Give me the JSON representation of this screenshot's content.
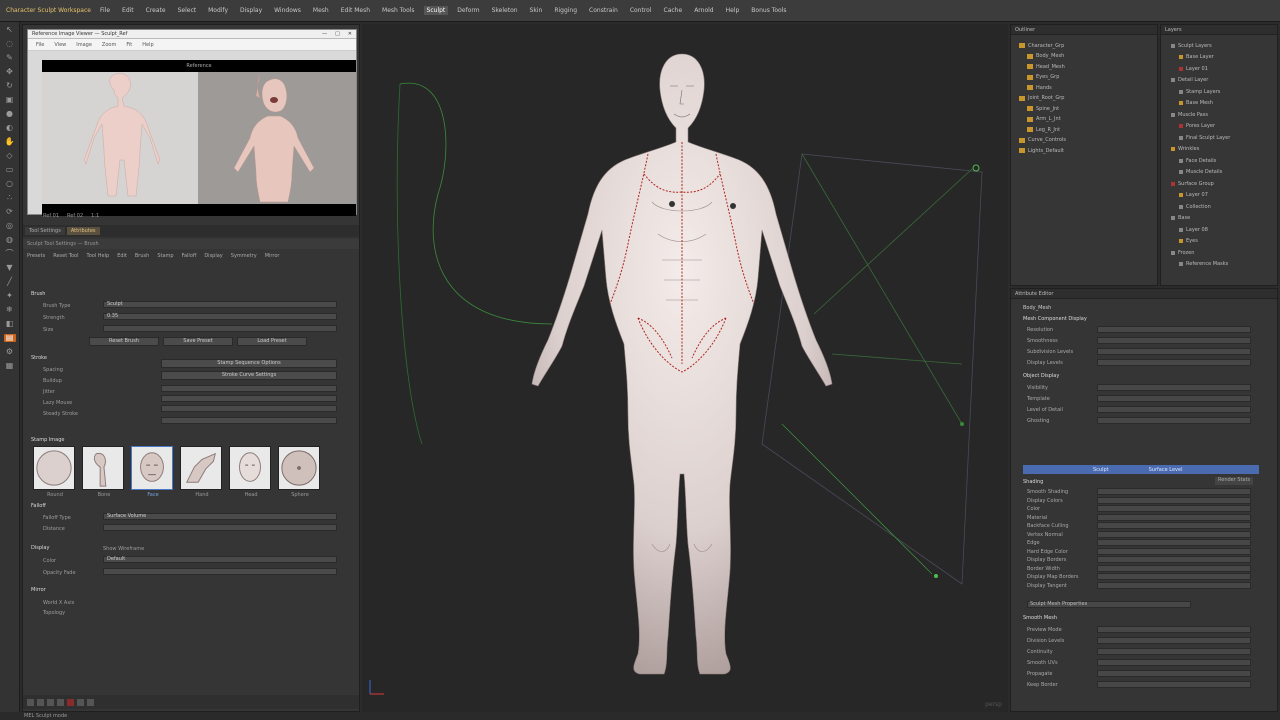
{
  "menubar": {
    "title": "Character Sculpt Workspace",
    "items": [
      "File",
      "Edit",
      "Create",
      "Select",
      "Modify",
      "Display",
      "Windows",
      "Mesh",
      "Edit Mesh",
      "Mesh Tools",
      "Sculpt",
      "Deform",
      "Skeleton",
      "Skin",
      "Rigging",
      "Constrain",
      "Control",
      "Cache",
      "Arnold",
      "Help",
      "Bonus Tools"
    ],
    "active_item": "Sculpt"
  },
  "tools": [
    {
      "icon": "select-arrow-icon",
      "glyph": "↖"
    },
    {
      "icon": "lasso-icon",
      "glyph": "◌"
    },
    {
      "icon": "paint-select-icon",
      "glyph": "✎"
    },
    {
      "icon": "move-icon",
      "glyph": "✥"
    },
    {
      "icon": "rotate-icon",
      "glyph": "↻"
    },
    {
      "icon": "scale-icon",
      "glyph": "▣"
    },
    {
      "icon": "sculpt-brush-icon",
      "glyph": "●"
    },
    {
      "icon": "smooth-icon",
      "glyph": "◐"
    },
    {
      "icon": "grab-icon",
      "glyph": "✋"
    },
    {
      "icon": "pinch-icon",
      "glyph": "◇"
    },
    {
      "icon": "flatten-icon",
      "glyph": "▭"
    },
    {
      "icon": "foamy-icon",
      "glyph": "○"
    },
    {
      "icon": "spray-icon",
      "glyph": "∴"
    },
    {
      "icon": "repeat-icon",
      "glyph": "⟳"
    },
    {
      "icon": "imprint-icon",
      "glyph": "◎"
    },
    {
      "icon": "wax-icon",
      "glyph": "◍"
    },
    {
      "icon": "scrape-icon",
      "glyph": "⌒"
    },
    {
      "icon": "fill-icon",
      "glyph": "▼"
    },
    {
      "icon": "knife-icon",
      "glyph": "╱"
    },
    {
      "icon": "amplify-icon",
      "glyph": "✦"
    },
    {
      "icon": "freeze-icon",
      "glyph": "❄"
    },
    {
      "icon": "mask-icon",
      "glyph": "◧"
    },
    {
      "icon": "camera-icon",
      "glyph": "▤"
    },
    {
      "icon": "settings-icon",
      "glyph": "⚙"
    },
    {
      "icon": "image-plane-icon",
      "glyph": "▦"
    }
  ],
  "reference": {
    "title": "Reference Image Viewer — Sculpt_Ref",
    "toolbar": [
      "File",
      "View",
      "Image",
      "Zoom",
      "Fit",
      "Help"
    ],
    "header": "Reference",
    "footer": [
      "Ref 01",
      "Ref 02",
      "1:1"
    ]
  },
  "left_tabs": [
    "Tool Settings",
    "Attributes"
  ],
  "left_sub": "Sculpt Tool Settings — Brush",
  "left_menu": [
    "Presets",
    "Reset Tool",
    "Tool Help",
    "Edit",
    "Brush",
    "Stamp",
    "Falloff",
    "Display",
    "Symmetry",
    "Mirror"
  ],
  "brush": {
    "section": "Brush",
    "label_type": "Brush Type",
    "type_value": "Sculpt",
    "label_strength": "Strength",
    "strength_value": "0.35",
    "label_size": "Size",
    "btn_reset": "Reset Brush",
    "btn_save": "Save Preset",
    "btn_load": "Load Preset"
  },
  "stroke": {
    "section": "Stroke",
    "labels": [
      "Spacing",
      "Buildup",
      "Jitter",
      "Lazy Mouse",
      "Steady Stroke"
    ],
    "btn_1": "Stamp Sequence Options",
    "btn_2": "Stroke Curve Settings"
  },
  "stamp": {
    "section": "Stamp Image",
    "thumbs": [
      "Round",
      "Bone",
      "Face",
      "Hand",
      "Head",
      "Sphere"
    ],
    "selected": 2
  },
  "falloff": {
    "section": "Falloff",
    "label": "Falloff Type",
    "value": "Surface Volume",
    "label2": "Distance"
  },
  "display": {
    "section": "Display",
    "label_a": "Show Wireframe",
    "label_b": "Color",
    "value_b": "Default",
    "label_c": "Opacity Fade"
  },
  "mirror": {
    "section": "Mirror",
    "label_a": "World X Axis",
    "label_b": "Topology"
  },
  "outliner": {
    "title": "Outliner",
    "rows": [
      {
        "label": "Character_Grp",
        "indent": 0
      },
      {
        "label": "Body_Mesh",
        "indent": 1
      },
      {
        "label": "Head_Mesh",
        "indent": 1
      },
      {
        "label": "Eyes_Grp",
        "indent": 1
      },
      {
        "label": "Hands",
        "indent": 1
      },
      {
        "label": "Joint_Root_Grp",
        "indent": 0
      },
      {
        "label": "Spine_Jnt",
        "indent": 1
      },
      {
        "label": "Arm_L_Jnt",
        "indent": 1
      },
      {
        "label": "Leg_R_Jnt",
        "indent": 1
      },
      {
        "label": "Curve_Controls",
        "indent": 0
      },
      {
        "label": "Lights_Default",
        "indent": 0
      }
    ]
  },
  "layers": {
    "title": "Layers",
    "items": [
      "Sculpt Layers",
      "Base Layer",
      "Layer 01",
      "Detail Layer",
      "Stamp Layers",
      "Base Mesh",
      "Muscle Pass",
      "Pores Layer",
      "Final Sculpt Layer",
      "Wrinkles",
      "Face Details",
      "Muscle Details",
      "Surface Group",
      "Layer 07",
      "Collection",
      "Base",
      "Layer 08",
      "Eyes",
      "Frozen",
      "Reference Masks"
    ]
  },
  "attrib": {
    "title": "Attribute Editor",
    "tab": "Body_Mesh",
    "section_a": "Mesh Component Display",
    "rows_a": [
      "Resolution",
      "Smoothness",
      "Subdivision Levels",
      "Display Levels"
    ],
    "section_b": "Object Display",
    "rows_b": [
      "Visibility",
      "Template",
      "Level of Detail",
      "Ghosting"
    ],
    "blue_bar": [
      "Sculpt",
      "Surface Level"
    ],
    "section_c": "Shading",
    "rows_c": [
      "Smooth Shading",
      "Display Colors",
      "Color",
      "Material",
      "Backface Culling",
      "Vertex Normal",
      "Edge",
      "Hard Edge Color",
      "Display Borders",
      "Border Width",
      "Display Map Borders",
      "Display Tangent"
    ],
    "section_d": "Render Stats",
    "dropdown": "Sculpt Mesh Properties",
    "section_e": "Smooth Mesh",
    "rows_e": [
      "Preview Mode",
      "Division Levels",
      "Continuity",
      "Smooth UVs",
      "Propagate",
      "Keep Border"
    ]
  },
  "status_bar": "MEL  Sculpt mode"
}
